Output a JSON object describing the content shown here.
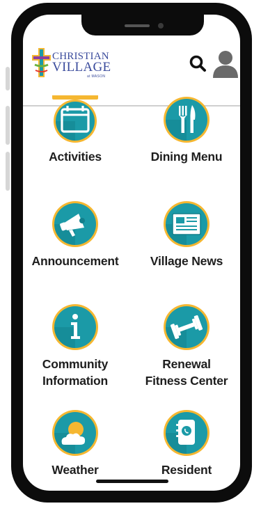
{
  "brand": {
    "name_line1": "CHRISTIAN",
    "name_line2": "VILLAGE",
    "tagline": "at MASON",
    "colors": {
      "teal": "#1b9aa7",
      "teal_dark": "#117f8b",
      "gold": "#f5b731",
      "navy": "#3a4b9c"
    }
  },
  "header": {
    "search_icon": "search-icon",
    "profile_icon": "user-profile-icon"
  },
  "menu": [
    {
      "key": "activities",
      "label": "Activities",
      "icon": "calendar-icon"
    },
    {
      "key": "dining",
      "label": "Dining Menu",
      "icon": "fork-knife-icon"
    },
    {
      "key": "announcement",
      "label": "Announcement",
      "icon": "megaphone-icon"
    },
    {
      "key": "news",
      "label": "Village News",
      "icon": "newspaper-icon"
    },
    {
      "key": "community",
      "label_line1": "Community",
      "label_line2": "Information",
      "icon": "info-icon"
    },
    {
      "key": "fitness",
      "label_line1": "Renewal",
      "label_line2": "Fitness Center",
      "icon": "dumbbell-icon"
    },
    {
      "key": "weather",
      "label": "Weather",
      "icon": "sun-cloud-icon"
    },
    {
      "key": "resident",
      "label": "Resident",
      "icon": "phone-book-icon"
    }
  ]
}
